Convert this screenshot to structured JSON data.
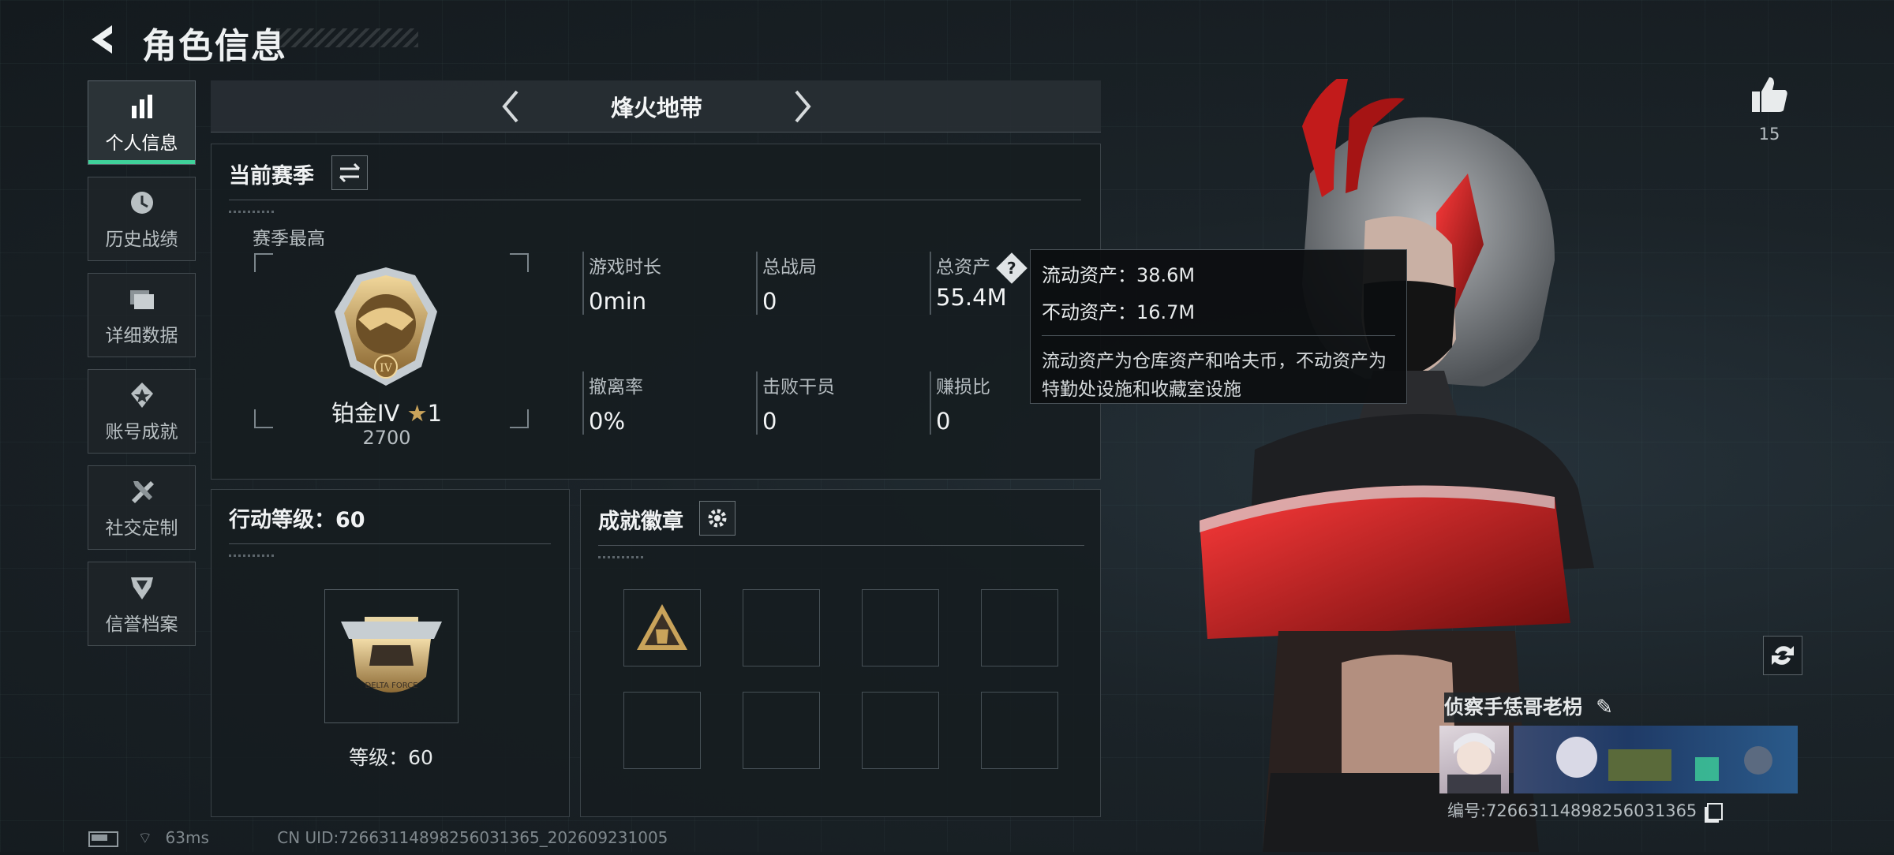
{
  "header": {
    "title": "角色信息"
  },
  "sidebar": {
    "items": [
      {
        "label": "个人信息",
        "icon": "bar-chart-icon",
        "active": true
      },
      {
        "label": "历史战绩",
        "icon": "clock-history-icon"
      },
      {
        "label": "详细数据",
        "icon": "folders-icon"
      },
      {
        "label": "账号成就",
        "icon": "achievement-star-icon"
      },
      {
        "label": "社交定制",
        "icon": "tools-icon"
      },
      {
        "label": "信誉档案",
        "icon": "shield-badge-icon"
      }
    ]
  },
  "mode_selector": {
    "label": "烽火地带"
  },
  "season": {
    "title": "当前赛季",
    "best_label": "赛季最高",
    "rank_name": "铂金IV",
    "rank_stars": "1",
    "rank_points": "2700",
    "stats": [
      {
        "label": "游戏时长",
        "value": "0min"
      },
      {
        "label": "总战局",
        "value": "0"
      },
      {
        "label": "总资产",
        "value": "55.4M"
      },
      {
        "label": "撤离率",
        "value": "0%"
      },
      {
        "label": "击败干员",
        "value": "0"
      },
      {
        "label": "赚损比",
        "value": "0"
      }
    ]
  },
  "tooltip": {
    "liquid": "流动资产：38.6M",
    "fixed": "不动资产：16.7M",
    "note": "流动资产为仓库资产和哈夫币，不动资产为特勤处设施和收藏室设施"
  },
  "action_level": {
    "title": "行动等级：60",
    "level_text": "等级：60",
    "emblem_text": "DELTA FORCE"
  },
  "achievements": {
    "title": "成就徽章"
  },
  "likes": {
    "count": "15"
  },
  "player": {
    "name": "侦察手恁哥老枴",
    "uid_line": "编号:72663114898256031365"
  },
  "status_bar": {
    "ping": "63ms",
    "uid": "CN UID:72663114898256031365_202609231005"
  },
  "colors": {
    "accent": "#3fd19a",
    "gold": "#c9a35a"
  }
}
